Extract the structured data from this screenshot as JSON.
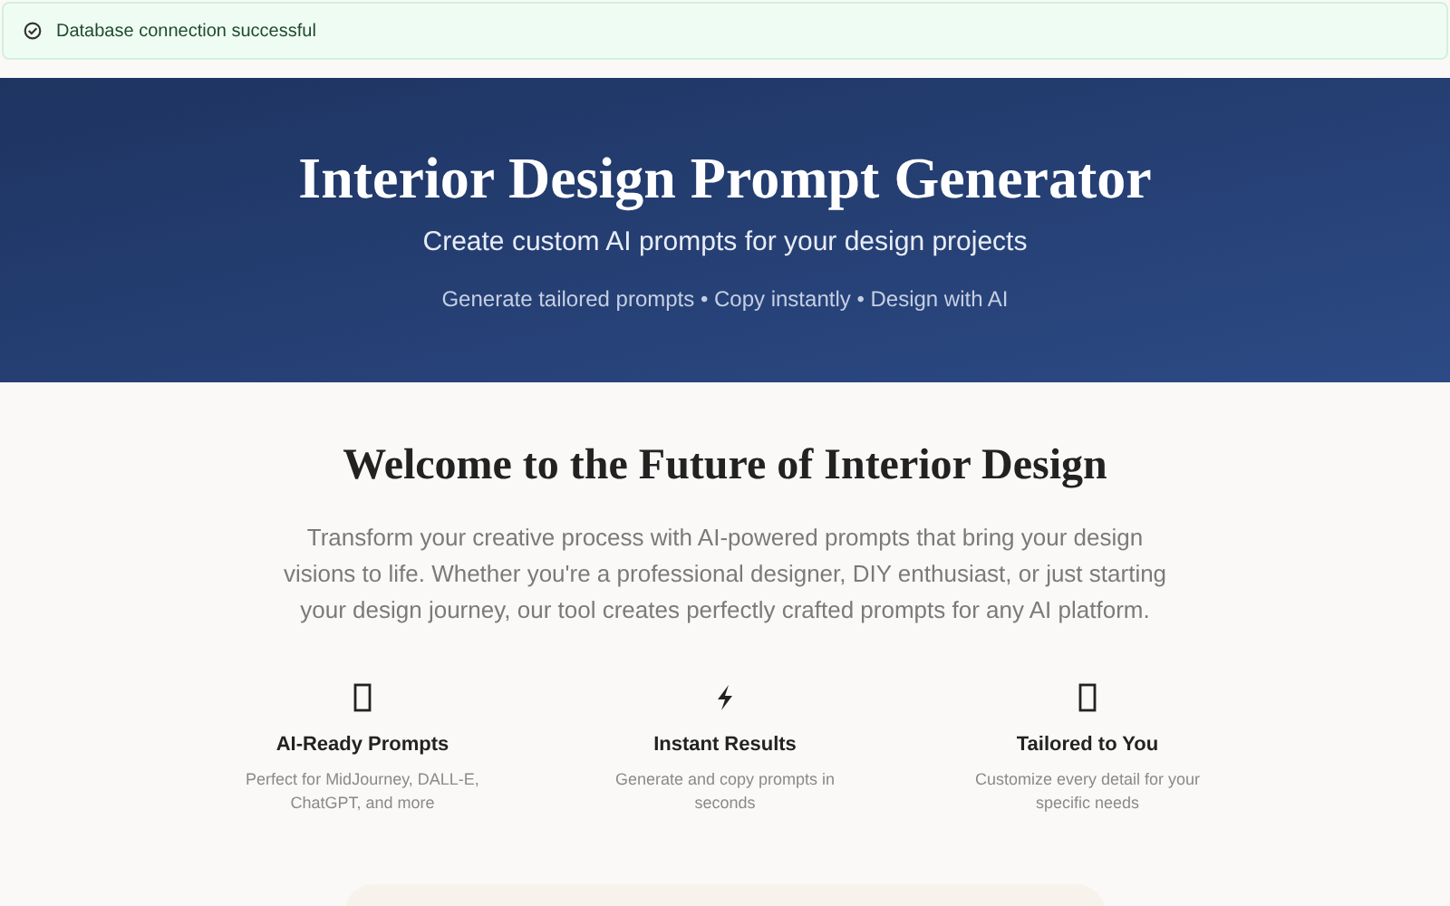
{
  "alert": {
    "text": "Database connection successful"
  },
  "hero": {
    "title": "Interior Design Prompt Generator",
    "subtitle": "Create custom AI prompts for your design projects",
    "tagline": "Generate tailored prompts • Copy instantly • Design with AI"
  },
  "welcome": {
    "heading": "Welcome to the Future of Interior Design",
    "intro": "Transform your creative process with AI-powered prompts that bring your design visions to life. Whether you're a professional designer, DIY enthusiast, or just starting your design journey, our tool creates perfectly crafted prompts for any AI platform."
  },
  "features": [
    {
      "kind": "box",
      "title": "AI-Ready Prompts",
      "text": "Perfect for MidJourney, DALL-E, ChatGPT, and more"
    },
    {
      "kind": "bolt",
      "title": "Instant Results",
      "text": "Generate and copy prompts in seconds"
    },
    {
      "kind": "box",
      "title": "Tailored to You",
      "text": "Customize every detail for your specific needs"
    }
  ]
}
